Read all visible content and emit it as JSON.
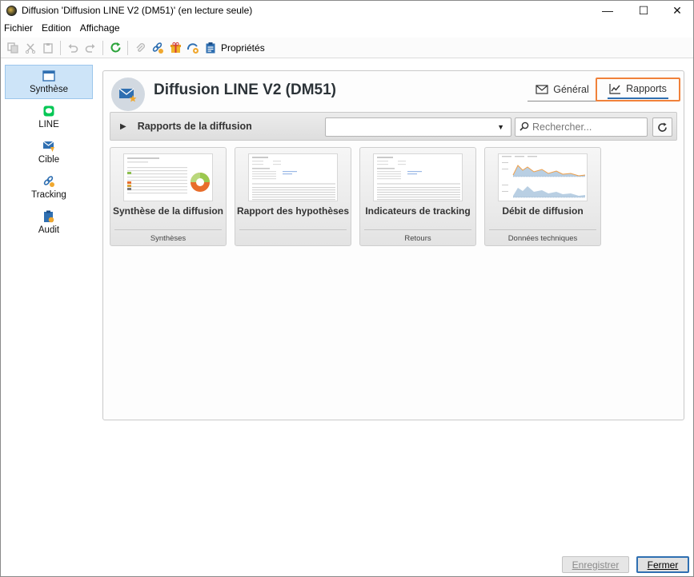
{
  "window": {
    "title": "Diffusion 'Diffusion LINE V2 (DM51)' (en lecture seule)",
    "minimize_glyph": "—",
    "maximize_glyph": "☐",
    "close_glyph": "✕"
  },
  "menu": {
    "items": [
      "Fichier",
      "Edition",
      "Affichage"
    ]
  },
  "toolbar": {
    "properties_label": "Propriétés",
    "icons": [
      "copy-icon",
      "cut-icon",
      "paste-icon",
      "undo-icon",
      "redo-icon",
      "refresh-icon",
      "attachment-icon",
      "link-icon",
      "gift-icon",
      "tracking-icon",
      "properties-icon"
    ]
  },
  "sidebar": {
    "items": [
      {
        "label": "Synthèse",
        "icon": "window-icon",
        "active": true
      },
      {
        "label": "LINE",
        "icon": "line-icon",
        "active": false
      },
      {
        "label": "Cible",
        "icon": "target-mail-icon",
        "active": false
      },
      {
        "label": "Tracking",
        "icon": "tracking-link-icon",
        "active": false
      },
      {
        "label": "Audit",
        "icon": "audit-icon",
        "active": false
      }
    ]
  },
  "main": {
    "title": "Diffusion LINE V2 (DM51)",
    "tabs": [
      {
        "label": "Général",
        "icon": "envelope-icon",
        "selected": false
      },
      {
        "label": "Rapports",
        "icon": "chart-icon",
        "selected": true
      }
    ],
    "section": {
      "title": "Rapports de la diffusion",
      "select_value": "",
      "search_placeholder": "Rechercher...",
      "search_value": ""
    },
    "reports": [
      {
        "title": "Synthèse de la diffusion",
        "category": "Synthèses"
      },
      {
        "title": "Rapport des hypothèses",
        "category": ""
      },
      {
        "title": "Indicateurs de tracking",
        "category": "Retours"
      },
      {
        "title": "Débit de diffusion",
        "category": "Données techniques"
      }
    ]
  },
  "footer": {
    "save_label": "Enregistrer",
    "close_label": "Fermer"
  },
  "colors": {
    "accent_blue": "#2f6fb1",
    "highlight_orange": "#f0813a",
    "active_sidebar": "#cde4f8"
  }
}
